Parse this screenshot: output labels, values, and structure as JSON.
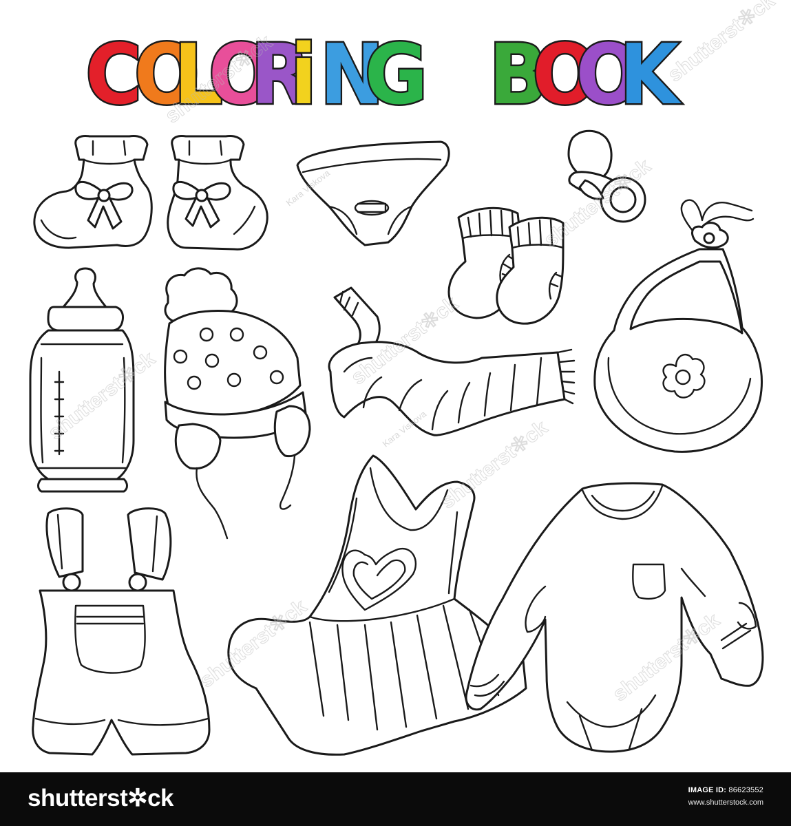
{
  "title": {
    "letters": [
      {
        "char": "C",
        "color": "#e3202a"
      },
      {
        "char": "O",
        "color": "#f07a1c"
      },
      {
        "char": "L",
        "color": "#f6c21a"
      },
      {
        "char": "O",
        "color": "#e84f9a"
      },
      {
        "char": "R",
        "color": "#9a56c8"
      },
      {
        "char": "i",
        "color": "#f2d21e"
      },
      {
        "char": "N",
        "color": "#3c9de0"
      },
      {
        "char": "G",
        "color": "#2bb44a"
      },
      {
        "char": "B",
        "color": "#3aa93a"
      },
      {
        "char": "O",
        "color": "#e11d2a"
      },
      {
        "char": "O",
        "color": "#9b4fc9"
      },
      {
        "char": "K",
        "color": "#2e92dd"
      }
    ]
  },
  "watermark": {
    "text": "shutterst✲ck",
    "author": "Kara Viskova"
  },
  "items": [
    {
      "name": "baby-booties"
    },
    {
      "name": "diaper"
    },
    {
      "name": "pacifier"
    },
    {
      "name": "knitted-socks"
    },
    {
      "name": "baby-bottle"
    },
    {
      "name": "pompom-hat"
    },
    {
      "name": "striped-scarf"
    },
    {
      "name": "bib"
    },
    {
      "name": "overalls"
    },
    {
      "name": "dress"
    },
    {
      "name": "bodysuit"
    }
  ],
  "footer": {
    "brand": "shutterst✲ck",
    "image_id_label": "IMAGE ID:",
    "image_id": "86623552",
    "site": "www.shutterstock.com"
  }
}
